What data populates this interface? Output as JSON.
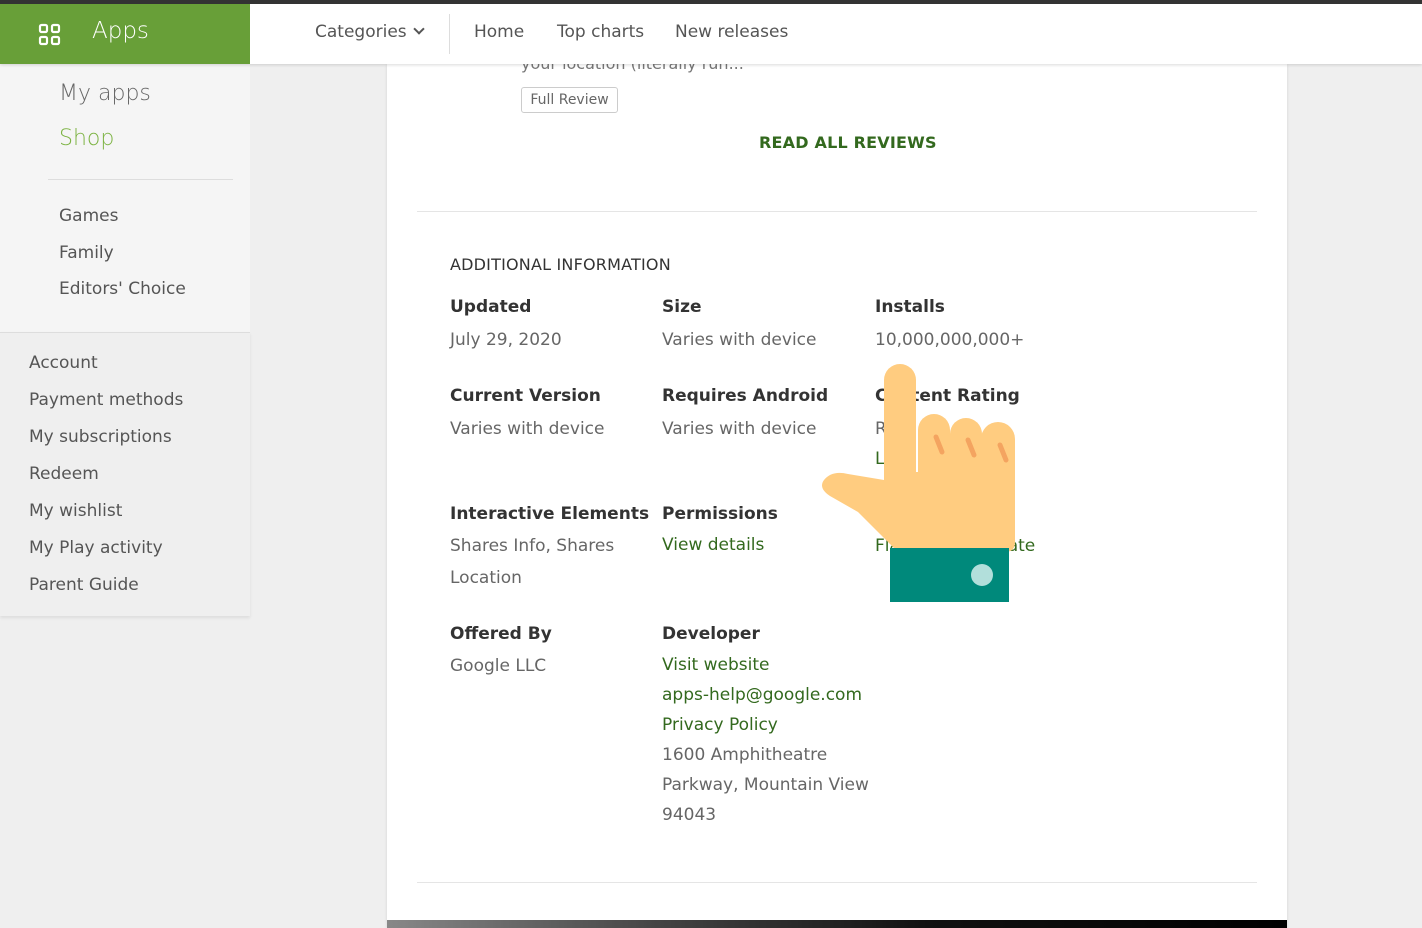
{
  "header": {
    "apps_label": "Apps",
    "nav": {
      "categories": "Categories",
      "home": "Home",
      "top_charts": "Top charts",
      "new_releases": "New releases"
    }
  },
  "sidebar": {
    "my_apps": "My apps",
    "shop": "Shop",
    "sections": [
      "Games",
      "Family",
      "Editors' Choice"
    ],
    "account_links": [
      "Account",
      "Payment methods",
      "My subscriptions",
      "Redeem",
      "My wishlist",
      "My Play activity",
      "Parent Guide"
    ]
  },
  "review": {
    "clipped_text": "your location (literally run...",
    "full_review": "Full Review",
    "read_all": "READ ALL REVIEWS"
  },
  "additional_info": {
    "title": "ADDITIONAL INFORMATION",
    "updated_label": "Updated",
    "updated_value": "July 29, 2020",
    "size_label": "Size",
    "size_value": "Varies with device",
    "installs_label": "Installs",
    "installs_value": "10,000,000,000+",
    "current_version_label": "Current Version",
    "current_version_value": "Varies with device",
    "requires_android_label": "Requires Android",
    "requires_android_value": "Varies with device",
    "content_rating_label": "Content Rating",
    "content_rating_partial_1": "R",
    "content_rating_partial_2": "L",
    "interactive_label": "Interactive Elements",
    "interactive_value_1": "Shares Info, Shares",
    "interactive_value_2": "Location",
    "permissions_label": "Permissions",
    "permissions_link": "View details",
    "flag_partial_left": "Fla",
    "flag_partial_right": "iate",
    "offered_by_label": "Offered By",
    "offered_by_value": "Google LLC",
    "developer_label": "Developer",
    "developer_website": "Visit website",
    "developer_email": "apps-help@google.com",
    "developer_privacy": "Privacy Policy",
    "developer_address_1": "1600 Amphitheatre",
    "developer_address_2": "Parkway, Mountain View",
    "developer_address_3": "94043"
  },
  "colors": {
    "brand_green": "#689f38",
    "shop_green": "#7cb342",
    "link_green": "#33691e",
    "hand_skin": "#ffcc80",
    "cuff": "#00897b"
  },
  "icons": [
    "apps-grid-icon",
    "chevron-down-icon",
    "pointing-hand-icon"
  ]
}
